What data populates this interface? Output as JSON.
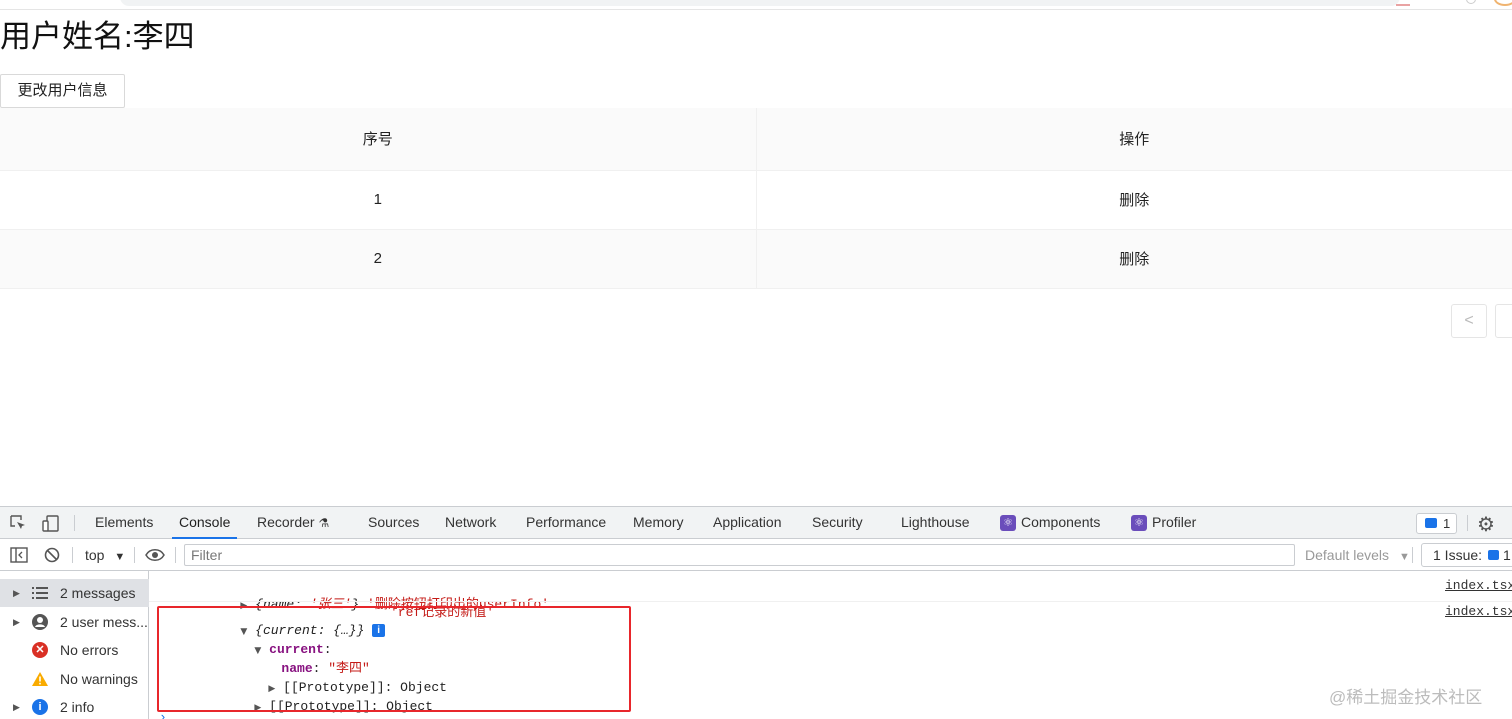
{
  "page": {
    "title": "用户姓名:李四",
    "change_button": "更改用户信息",
    "table": {
      "headers": [
        "序号",
        "操作"
      ],
      "rows": [
        {
          "index": "1",
          "action": "删除"
        },
        {
          "index": "2",
          "action": "删除"
        }
      ]
    },
    "pagination_prev": "<"
  },
  "devtools": {
    "tabs": [
      "Elements",
      "Console",
      "Recorder",
      "Sources",
      "Network",
      "Performance",
      "Memory",
      "Application",
      "Security",
      "Lighthouse",
      "Components",
      "Profiler"
    ],
    "active_tab": "Console",
    "message_badge_count": "1",
    "context": "top",
    "filter_placeholder": "Filter",
    "levels": "Default levels",
    "issues": "1 Issue:",
    "issues_count": "1",
    "sidebar": [
      {
        "label": "2 messages",
        "icon": "list-icon"
      },
      {
        "label": "2 user mess...",
        "icon": "user-icon"
      },
      {
        "label": "No errors",
        "icon": "error-icon"
      },
      {
        "label": "No warnings",
        "icon": "warning-icon"
      },
      {
        "label": "2 info",
        "icon": "info-icon"
      }
    ],
    "console": {
      "line1_obj_key": "name",
      "line1_obj_val": "'张三'",
      "line1_msg": "'删除按钮打印出的userInfo'",
      "line1_src": "index.tsx",
      "line2_obj": "{current: {…}}",
      "line2_msg": "'ref记录的新值'",
      "line2_src": "index.tsx",
      "current_key": "current",
      "name_key": "name",
      "name_val": "\"李四\"",
      "proto_inner": "[[Prototype]]: Object",
      "proto_outer": "[[Prototype]]: Object"
    },
    "watermark": "@稀土掘金技术社区"
  }
}
